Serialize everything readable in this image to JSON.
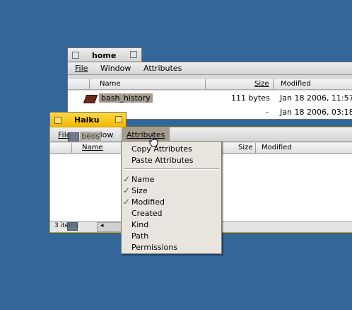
{
  "home_window": {
    "title": "home",
    "menu": [
      "File",
      "Window",
      "Attributes"
    ],
    "columns": [
      "Name",
      "Size",
      "Modified"
    ],
    "rows": [
      {
        "name": "bash_history",
        "size": "111 bytes",
        "modified": "Jan 18 2006, 11:57"
      },
      {
        "name": "",
        "size": "-",
        "modified": "Jan 18 2006, 03:18"
      }
    ]
  },
  "haiku_window": {
    "title": "Haiku",
    "menu": [
      "File",
      "Window",
      "Attributes"
    ],
    "columns": [
      "Name",
      "Size",
      "Modified"
    ],
    "dragged_item": "beos",
    "status": "3 items"
  },
  "attributes_menu": {
    "items": [
      {
        "label": "Copy Attributes",
        "checked": false
      },
      {
        "label": "Paste Attributes",
        "checked": false
      },
      {
        "label": "Name",
        "checked": true
      },
      {
        "label": "Size",
        "checked": true
      },
      {
        "label": "Modified",
        "checked": true
      },
      {
        "label": "Created",
        "checked": false
      },
      {
        "label": "Kind",
        "checked": false
      },
      {
        "label": "Path",
        "checked": false
      },
      {
        "label": "Permissions",
        "checked": false
      }
    ],
    "check_glyph": "✓"
  },
  "colors": {
    "desktop": "#336699",
    "active_tab": "#ffcb00",
    "inactive_tab": "#e0e0e0",
    "menu_bg": "#e8e5df",
    "selection": "#a59c8e"
  }
}
